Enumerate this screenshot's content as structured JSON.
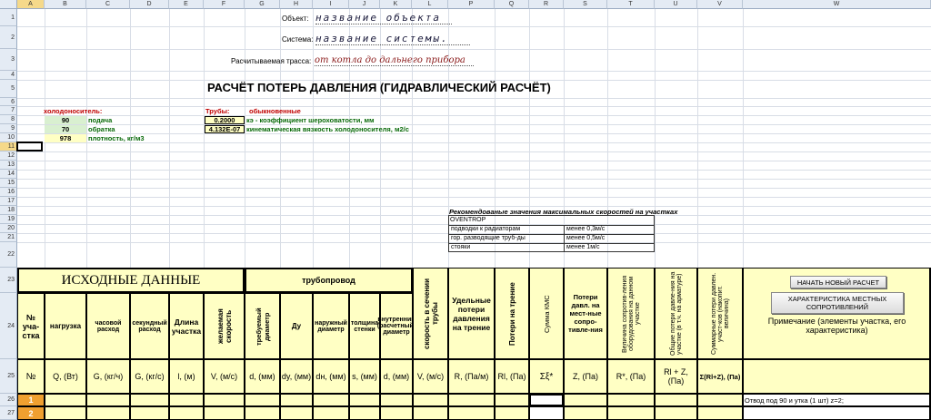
{
  "columns": [
    "A",
    "B",
    "C",
    "D",
    "E",
    "F",
    "G",
    "H",
    "I",
    "J",
    "K",
    "L",
    "P",
    "Q",
    "R",
    "S",
    "T",
    "U",
    "V",
    "W"
  ],
  "rows": [
    "1",
    "2",
    "3",
    "4",
    "5",
    "6",
    "7",
    "8",
    "9",
    "10",
    "11",
    "12",
    "13",
    "14",
    "15",
    "16",
    "17",
    "18",
    "19",
    "20",
    "21",
    "22",
    "23",
    "24",
    "25",
    "26",
    "27"
  ],
  "header": {
    "object_label": "Объект:",
    "object_value": "название объекта",
    "system_label": "Система:",
    "system_value": "название системы.",
    "route_label": "Расчитываемая трасса:",
    "route_value": "от котла до дальнего прибора",
    "title": "РАСЧЁТ ПОТЕРЬ ДАВЛЕНИЯ (ГИДРАВЛИЧЕСКИЙ РАСЧЁТ)"
  },
  "coolant": {
    "label": "холодоноситель:",
    "supply_value": "90",
    "supply_label": "подача",
    "return_value": "70",
    "return_label": "обратка",
    "density_value": "978",
    "density_label": "плотность, кг/м3"
  },
  "pipes": {
    "label": "Трубы:",
    "kind": "обыкновенные",
    "roughness_value": "0.2000",
    "roughness_label": "кэ - коэффициент шероховатости, мм",
    "viscosity_value": "4.132E-07",
    "viscosity_label": "кинематическая вязкость холодоносителя, м2/с"
  },
  "recommend": {
    "title": "Рекомендованые значения максимальных скоростей на участках",
    "brand": "OVENTROP",
    "rows": [
      {
        "name": "подводки к радиаторам",
        "value": "менее 0,3м/с"
      },
      {
        "name": "гор. разводящие труб-ды",
        "value": "менее 0,5м/с"
      },
      {
        "name": "стояки",
        "value": "менее 1м/с"
      }
    ]
  },
  "table": {
    "group_input": "ИСХОДНЫЕ ДАННЫЕ",
    "group_pipe": "трубопровод",
    "col_num": "№ уча-стка",
    "col_load": "нагрузка",
    "col_hourly": "часовой расход",
    "col_second": "секундный расход",
    "col_length": "Длина участка",
    "col_speed_want": "желаемая скорость",
    "col_req_diam": "требуемый диаметр",
    "col_du": "Ду",
    "col_outer": "наружный диаметр",
    "col_wall": "толщина стенки",
    "col_inner": "внутренний (расчетный) диаметр",
    "col_velocity": "скорость в сечении трубы",
    "col_spec_loss": "Удельные потери давления на трение",
    "col_friction": "Потери на трение",
    "col_kms": "Сумма КМС",
    "col_local": "Потери давл. на мест-ные сопро-тивле-ния",
    "col_equip": "Величина сопротив-ления оборудования на данном участке",
    "col_total": "Общие потери давле-ния на участке (в т.ч. на арматуре)",
    "col_sum": "Суммарные потери давлен. участ-ков (накопит. величина)",
    "col_note": "Примечание (элементы участка, его характеристика)",
    "u_num": "№",
    "u_load": "Q, (Вт)",
    "u_hourly": "G, (кг/ч)",
    "u_second": "G, (кг/с)",
    "u_length": "l, (м)",
    "u_speed": "V, (м/с)",
    "u_d": "d, (мм)",
    "u_dy": "dy, (мм)",
    "u_dn": "dн, (мм)",
    "u_s": "s, (мм)",
    "u_din": "d, (мм)",
    "u_v": "V, (м/с)",
    "u_r": "R, (Па/м)",
    "u_rl": "Rl, (Па)",
    "u_xi": "Σξ*",
    "u_z": "Z, (Па)",
    "u_req": "R*, (Па)",
    "u_rlz": "Rl + Z, (Па)",
    "u_sum": "Σ(Rl+Z), (Па)",
    "row1_num": "1",
    "row2_num": "2",
    "row1_note": "Отвод под 90 и утка (1 шт) z=2;"
  },
  "buttons": {
    "new_calc": "НАЧАТЬ НОВЫЙ РАСЧЕТ",
    "local_res": "ХАРАКТЕРИСТИКА МЕСТНЫХ СОПРОТИВЛЕНИЙ"
  },
  "colors": {
    "yellow": "#ffffc4",
    "green": "#0a6a0a",
    "red": "#c00000",
    "header_bg": "#e4ebf4",
    "selected": "#f5d98a",
    "sel_num_bg": "#f0a030"
  }
}
